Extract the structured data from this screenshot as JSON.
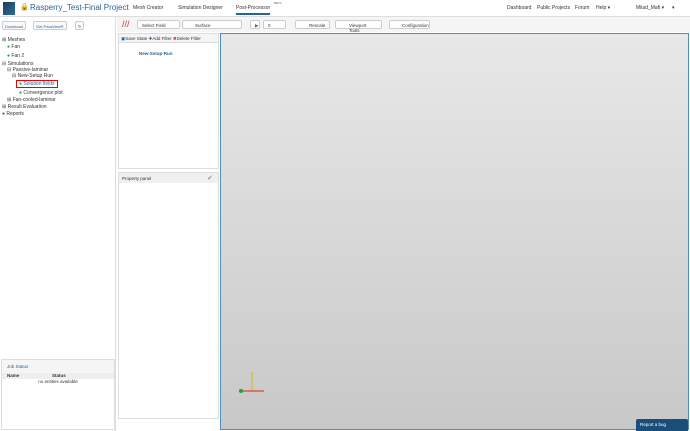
{
  "header": {
    "project_title": "Rasperry_Test-Final Project",
    "tabs": [
      "Mesh Creator",
      "Simulation Designer",
      "Post-Processor"
    ],
    "beta": "BETA",
    "right_nav": [
      "Dashboard",
      "Public Projects",
      "Forum",
      "Help ▾",
      "Milad_Mafi ▾",
      "▾"
    ]
  },
  "left": {
    "buttons": [
      "Download",
      "Get ParaView®",
      "↻"
    ],
    "tree": [
      "Meshes",
      "Fan",
      "Fan 2",
      "Simulations",
      "Passive-laminar",
      "New-Setup Run",
      "Solution fields",
      "Convergence plot",
      "Fan-cooled-laminar",
      "Result Evaluation",
      "Reports"
    ]
  },
  "job_status": {
    "title": "Job Status",
    "columns": [
      "Name",
      "Status"
    ],
    "empty": "no entities available"
  },
  "toolbar": {
    "field": "Select Field",
    "representation": "Surface",
    "frame": "0",
    "rescale": "Rescale",
    "viewport": "Viewport Tools",
    "config": "Configuration"
  },
  "filters": {
    "save": "Save State",
    "add": "Add Filter",
    "delete": "Delete Filter",
    "item": "New-Setup-Run"
  },
  "property_panel": {
    "title": "Property panel"
  },
  "report_bug": "Report a bug"
}
